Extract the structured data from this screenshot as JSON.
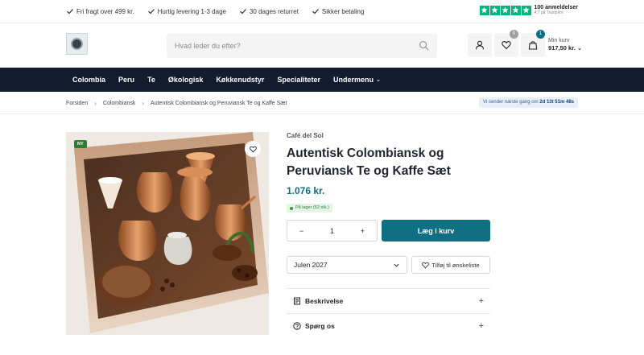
{
  "topbar": {
    "usps": [
      "Fri fragt over 499 kr.",
      "Hurtig levering 1-3 dage",
      "30 dages returret",
      "Sikker betaling"
    ],
    "trustpilot": {
      "reviews": "100 anmeldelser",
      "rating": "4.7 på Trustpilot",
      "stars": 5,
      "color": "#00b67a"
    }
  },
  "header": {
    "search_placeholder": "Hvad leder du efter?",
    "wishlist_count": "0",
    "cart_count": "1",
    "cart_label": "Min kurv",
    "cart_total": "917,50 kr."
  },
  "nav": {
    "items": [
      "Colombia",
      "Peru",
      "Te",
      "Økologisk",
      "Køkkenudstyr",
      "Specialiteter",
      "Undermenu"
    ]
  },
  "breadcrumb": [
    "Forsiden",
    "Colombiansk",
    "Autentisk Colombiansk og Peruviansk Te og Kaffe Sæt"
  ],
  "shipping": {
    "text": "Vi sender næste gang om",
    "countdown": "2d 13t 51m 48s"
  },
  "product": {
    "badge": "NY",
    "brand": "Café del Sol",
    "title": "Autentisk Colombiansk og Peruviansk Te og Kaffe Sæt",
    "price": "1.076 kr.",
    "stock": "På lager (52 stk.)",
    "quantity": "1",
    "add_to_cart": "Læg i kurv",
    "variant": "Julen 2027",
    "wishlist": "Tilføj til ønskeliste",
    "accordions": [
      "Beskrivelse",
      "Spørg os"
    ]
  },
  "colors": {
    "nav_bg": "#131c2e",
    "accent": "#116f84",
    "price": "#0e6f84"
  }
}
